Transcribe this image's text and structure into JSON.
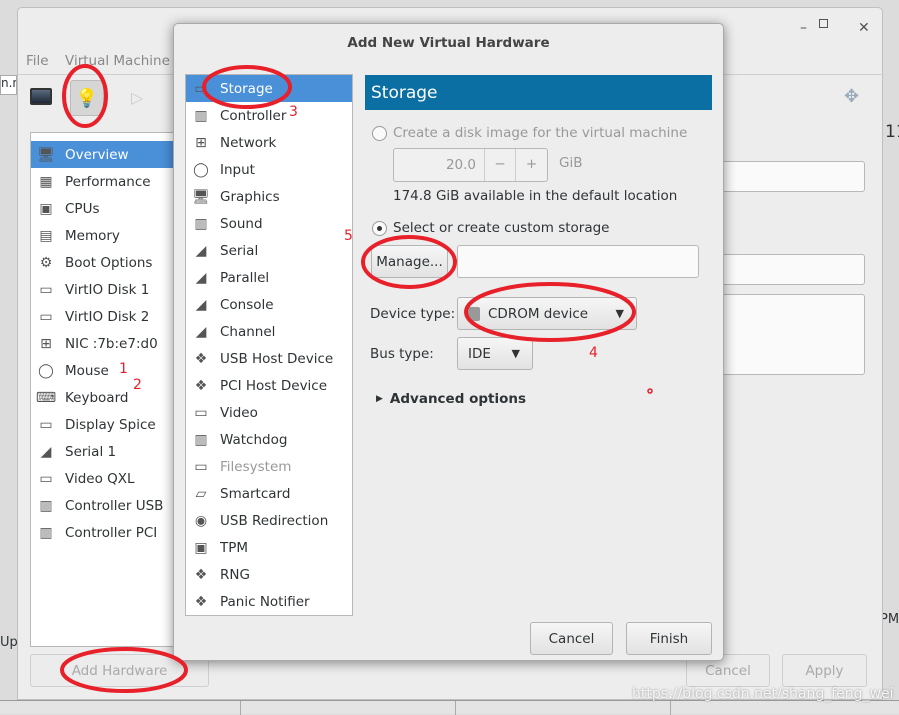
{
  "background": {
    "fragments": {
      "url_stub": "n.n",
      "up": "Up",
      "pm": "PM",
      "num": "11"
    }
  },
  "main_window": {
    "menu": [
      "File",
      "Virtual Machine"
    ],
    "toolbar": [
      "monitor-icon",
      "lightbulb-icon",
      "play-icon"
    ],
    "sidebar": [
      {
        "label": "Overview",
        "icon": "monitor-icon",
        "selected": true
      },
      {
        "label": "Performance",
        "icon": "performance-icon"
      },
      {
        "label": "CPUs",
        "icon": "cpu-icon"
      },
      {
        "label": "Memory",
        "icon": "memory-icon"
      },
      {
        "label": "Boot Options",
        "icon": "gears-icon"
      },
      {
        "label": "VirtIO Disk 1",
        "icon": "disk-icon"
      },
      {
        "label": "VirtIO Disk 2",
        "icon": "disk-icon"
      },
      {
        "label": "NIC :7b:e7:d0",
        "icon": "network-icon"
      },
      {
        "label": "Mouse",
        "icon": "mouse-icon"
      },
      {
        "label": "Keyboard",
        "icon": "keyboard-icon"
      },
      {
        "label": "Display Spice",
        "icon": "display-icon"
      },
      {
        "label": "Serial 1",
        "icon": "serial-icon"
      },
      {
        "label": "Video QXL",
        "icon": "video-icon"
      },
      {
        "label": "Controller USB",
        "icon": "controller-icon"
      },
      {
        "label": "Controller PCI",
        "icon": "controller-icon"
      }
    ],
    "add_hardware": "Add Hardware",
    "cancel": "Cancel",
    "apply": "Apply"
  },
  "dialog": {
    "title": "Add New Virtual Hardware",
    "items": [
      {
        "label": "Storage",
        "icon": "disk-icon",
        "selected": true
      },
      {
        "label": "Controller",
        "icon": "controller-icon"
      },
      {
        "label": "Network",
        "icon": "network-icon"
      },
      {
        "label": "Input",
        "icon": "mouse-icon"
      },
      {
        "label": "Graphics",
        "icon": "monitor-icon"
      },
      {
        "label": "Sound",
        "icon": "sound-card-icon"
      },
      {
        "label": "Serial",
        "icon": "serial-icon"
      },
      {
        "label": "Parallel",
        "icon": "parallel-icon"
      },
      {
        "label": "Console",
        "icon": "console-icon"
      },
      {
        "label": "Channel",
        "icon": "channel-icon"
      },
      {
        "label": "USB Host Device",
        "icon": "usb-icon"
      },
      {
        "label": "PCI Host Device",
        "icon": "pci-icon"
      },
      {
        "label": "Video",
        "icon": "video-icon"
      },
      {
        "label": "Watchdog",
        "icon": "watchdog-icon"
      },
      {
        "label": "Filesystem",
        "icon": "folder-icon",
        "disabled": true
      },
      {
        "label": "Smartcard",
        "icon": "smartcard-icon"
      },
      {
        "label": "USB Redirection",
        "icon": "usb-redirection-icon"
      },
      {
        "label": "TPM",
        "icon": "chip-icon"
      },
      {
        "label": "RNG",
        "icon": "rng-icon"
      },
      {
        "label": "Panic Notifier",
        "icon": "panic-icon"
      }
    ],
    "header": "Storage",
    "create_disk_label": "Create a disk image for the virtual machine",
    "size_value": "20.0",
    "size_unit": "GiB",
    "minus": "−",
    "plus": "+",
    "available": "174.8 GiB available in the default location",
    "custom_label": "Select or create custom storage",
    "manage": "Manage...",
    "path_value": "",
    "device_type_label": "Device type:",
    "device_type": "CDROM device",
    "bus_type_label": "Bus type:",
    "bus_type": "IDE",
    "advanced": "Advanced options",
    "cancel": "Cancel",
    "finish": "Finish"
  },
  "annotations": {
    "n1": "1",
    "n2": "2",
    "n3": "3",
    "n4": "4",
    "n5": "5",
    "color": "#e8202a"
  },
  "watermark": "https://blog.csdn.net/shang_feng_wei",
  "colors": {
    "selection": "#4a90d9",
    "header": "#0b6fa4"
  }
}
